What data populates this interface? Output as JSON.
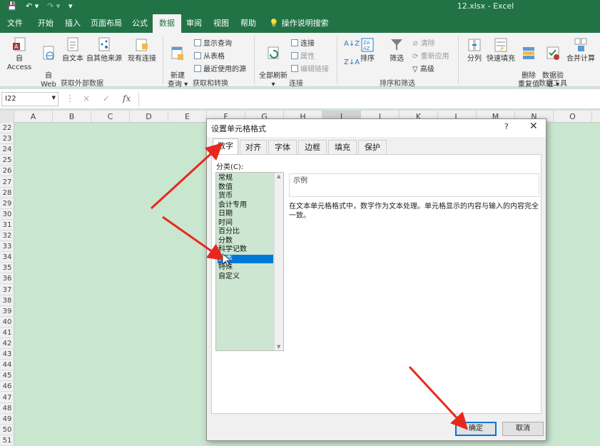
{
  "titlebar": {
    "file_name": "12.xlsx",
    "app": "Excel",
    "separator": " - "
  },
  "menu": {
    "tabs": [
      "文件",
      "开始",
      "插入",
      "页面布局",
      "公式",
      "数据",
      "审阅",
      "视图",
      "帮助"
    ],
    "active": "数据",
    "tell_me": "操作说明搜索"
  },
  "ribbon": {
    "groups": {
      "external": {
        "label": "获取外部数据",
        "buttons": [
          "自 Access",
          "自\nWeb",
          "自文本",
          "自其他来源",
          "现有连接"
        ]
      },
      "transform": {
        "label": "获取和转换",
        "new_query": "新建\n查询 ▾",
        "items": [
          "显示查询",
          "从表格",
          "最近使用的源"
        ]
      },
      "connections": {
        "label": "连接",
        "refresh_all": "全部刷新\n▾",
        "items": [
          "连接",
          "属性",
          "编辑链接"
        ]
      },
      "sort_filter": {
        "label": "排序和筛选",
        "sort": "排序",
        "filter": "筛选",
        "items": [
          "清除",
          "重新应用",
          "高级"
        ]
      },
      "data_tools": {
        "label": "数据工具",
        "buttons": [
          "分列",
          "快速填充",
          "删除\n重复值",
          "数据验\n证 ▾",
          "合并计算"
        ]
      }
    }
  },
  "formula_bar": {
    "name_box": "I22",
    "fx": "fx",
    "cancel": "×",
    "enter": "✓"
  },
  "grid": {
    "columns": [
      "A",
      "B",
      "C",
      "D",
      "E",
      "F",
      "G",
      "H",
      "I",
      "J",
      "K",
      "L",
      "M",
      "N",
      "O"
    ],
    "rows": [
      "22",
      "23",
      "24",
      "25",
      "26",
      "27",
      "28",
      "29",
      "30",
      "31",
      "32",
      "33",
      "34",
      "35",
      "36",
      "37",
      "38",
      "39",
      "40",
      "41",
      "42",
      "43",
      "44",
      "45",
      "46",
      "47",
      "48",
      "49",
      "50",
      "51"
    ]
  },
  "dialog": {
    "title": "设置单元格格式",
    "help": "?",
    "close": "✕",
    "tabs": [
      "数字",
      "对齐",
      "字体",
      "边框",
      "填充",
      "保护"
    ],
    "active_tab": "数字",
    "category_label": "分类(C):",
    "categories": [
      "常规",
      "数值",
      "货币",
      "会计专用",
      "日期",
      "时间",
      "百分比",
      "分数",
      "科学记数",
      "文本",
      "特殊",
      "自定义"
    ],
    "selected_category": "文本",
    "sample_label": "示例",
    "description": "在文本单元格格式中，数字作为文本处理。单元格显示的内容与输入的内容完全一致。",
    "ok": "确定",
    "cancel": "取消"
  },
  "colors": {
    "excel_green": "#217346",
    "sheet_fill": "#c9e6cf",
    "selection": "#0078d7",
    "arrow": "#e8281e"
  }
}
